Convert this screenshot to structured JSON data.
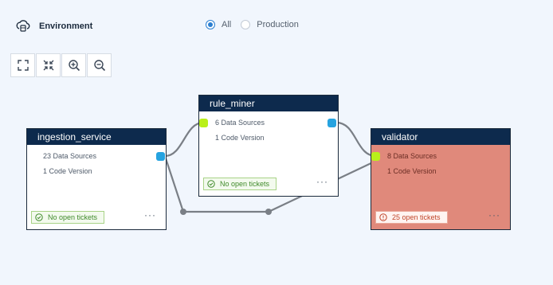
{
  "header": {
    "title": "Environment",
    "icon": "cloud-database-icon"
  },
  "filter": {
    "options": [
      {
        "label": "All",
        "checked": true
      },
      {
        "label": "Production",
        "checked": false
      }
    ]
  },
  "toolbar": {
    "buttons": [
      "fit-screen-icon",
      "collapse-icon",
      "zoom-in-icon",
      "zoom-out-icon"
    ]
  },
  "nodes": {
    "ingestion": {
      "title": "ingestion_service",
      "sources": "23 Data Sources",
      "versions": "1 Code Version",
      "tickets": "No open tickets"
    },
    "rule_miner": {
      "title": "rule_miner",
      "sources": "6 Data Sources",
      "versions": "1 Code Version",
      "tickets": "No open tickets"
    },
    "validator": {
      "title": "validator",
      "sources": "8 Data Sources",
      "versions": "1 Code Version",
      "tickets": "25 open tickets"
    }
  },
  "more_glyph": "···",
  "colors": {
    "header_bg": "#0d2a4d",
    "alert_bg": "#e0897b",
    "port_blue": "#26a3e0",
    "port_green": "#b9f01a",
    "accent": "#2b7fd1"
  }
}
